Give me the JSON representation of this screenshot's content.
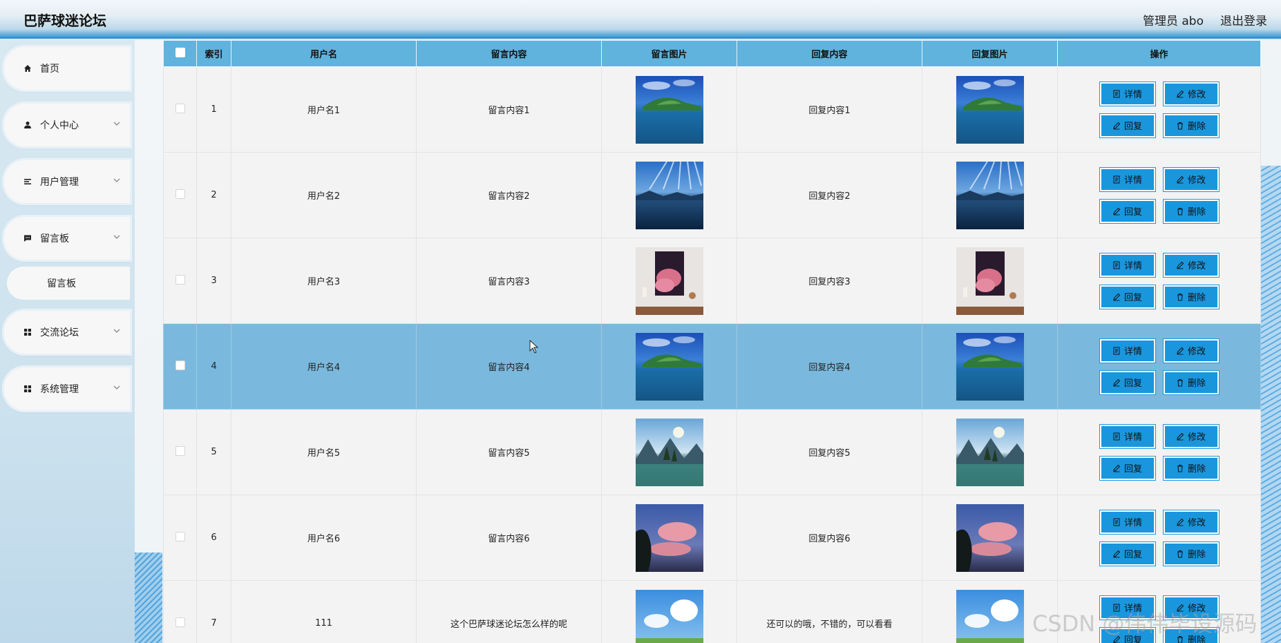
{
  "header": {
    "title": "巴萨球迷论坛",
    "user_label": "管理员 abo",
    "logout_label": "退出登录"
  },
  "sidebar": {
    "items": [
      {
        "label": "首页",
        "icon": "home-icon"
      },
      {
        "label": "个人中心",
        "icon": "user-icon"
      },
      {
        "label": "用户管理",
        "icon": "list-icon"
      },
      {
        "label": "留言板",
        "icon": "message-icon"
      },
      {
        "label": "交流论坛",
        "icon": "grid-icon"
      },
      {
        "label": "系统管理",
        "icon": "grid-icon"
      }
    ],
    "subitem": {
      "label": "留言板"
    }
  },
  "table": {
    "headers": [
      "",
      "索引",
      "用户名",
      "留言内容",
      "留言图片",
      "回复内容",
      "回复图片",
      "操作"
    ],
    "buttons": {
      "detail": "详情",
      "edit": "修改",
      "reply": "回复",
      "delete": "删除"
    },
    "rows": [
      {
        "index": "1",
        "username": "用户名1",
        "message": "留言内容1",
        "reply": "回复内容1",
        "image": "island-lake"
      },
      {
        "index": "2",
        "username": "用户名2",
        "message": "留言内容2",
        "reply": "回复内容2",
        "image": "mountain-lake-sky"
      },
      {
        "index": "3",
        "username": "用户名3",
        "message": "留言内容3",
        "reply": "回复内容3",
        "image": "pink-cloud-poster"
      },
      {
        "index": "4",
        "username": "用户名4",
        "message": "留言内容4",
        "reply": "回复内容4",
        "image": "island-lake"
      },
      {
        "index": "5",
        "username": "用户名5",
        "message": "留言内容5",
        "reply": "回复内容5",
        "image": "alpine-valley"
      },
      {
        "index": "6",
        "username": "用户名6",
        "message": "留言内容6",
        "reply": "回复内容6",
        "image": "pink-sky-tree"
      },
      {
        "index": "7",
        "username": "111",
        "message": "这个巴萨球迷论坛怎么样的呢",
        "reply": "还可以的哦，不错的，可以看看",
        "image": "blue-sky-meadow"
      }
    ]
  },
  "watermark": "CSDN @伟伟毕设源码",
  "colors": {
    "accent": "#1a96dd",
    "header_row": "#5fb3dc",
    "active_row": "#7ab9dd"
  }
}
